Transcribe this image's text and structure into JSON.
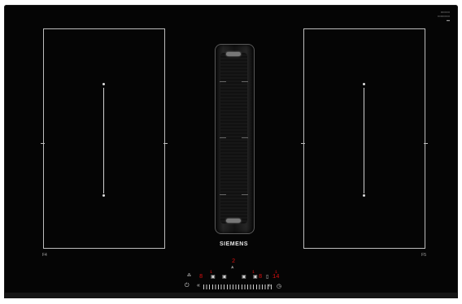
{
  "brand": {
    "name": "SIEMENS"
  },
  "zones": {
    "left_label": "F4",
    "right_label": "F5"
  },
  "vent": {
    "name": "downdraft-extractor-vent"
  },
  "control_panel": {
    "red_top": "2",
    "red_a": "1",
    "red_b": "1",
    "red_c": "1",
    "red_display_left": "8",
    "red_display_mid": "8",
    "red_display_right": "14",
    "power_symbol": "⏻",
    "timer_symbol": "◷",
    "minus_symbol": "«",
    "plus_symbol": "»"
  },
  "colors": {
    "background": "#050505",
    "zone_outline": "#bdbdbd",
    "display_red": "#e01010"
  }
}
